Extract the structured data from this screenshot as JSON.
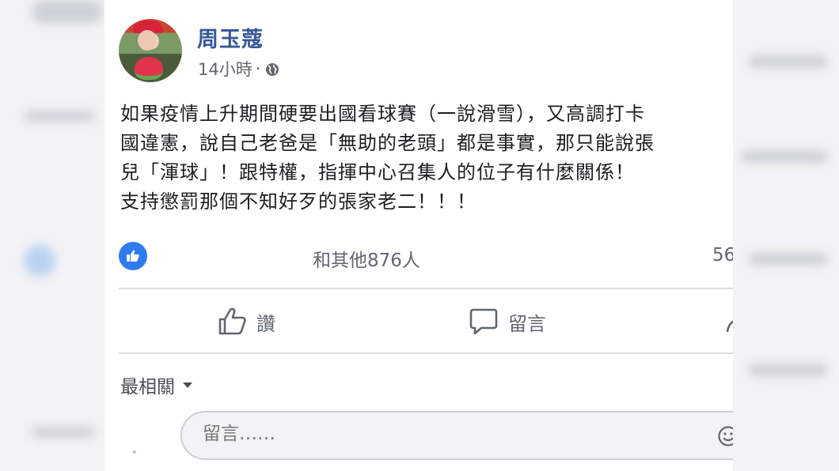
{
  "post": {
    "author": "周玉蔻",
    "time": "14小時",
    "separator": "·",
    "body_lines": [
      "如果疫情上升期間硬要出國看球賽（一說滑雪），又高調打卡",
      "國違憲，說自己老爸是「無助的老頭」都是事實，那只能說張",
      "兒「渾球」！跟特權，指揮中心召集人的位子有什麼關係！",
      "支持懲罰那個不知好歹的張家老二！！！"
    ]
  },
  "reactions": {
    "summary": "和其他876人",
    "comments": "56"
  },
  "actions": {
    "like": "讚",
    "comment": "留言"
  },
  "comments_section": {
    "sort_label": "最相關",
    "input_placeholder": "留言……"
  },
  "icons": {
    "globe": "globe-icon",
    "like_badge": "thumbs-up-icon",
    "like_action": "thumbs-up-outline-icon",
    "comment_action": "speech-bubble-icon",
    "share_action": "share-arrow-icon",
    "sort_caret": "caret-down-icon",
    "emoji": "smile-icon"
  },
  "colors": {
    "author": "#385898",
    "like_badge": "#2e7bf0",
    "meta_text": "#606770",
    "body_text": "#1c1e21"
  }
}
